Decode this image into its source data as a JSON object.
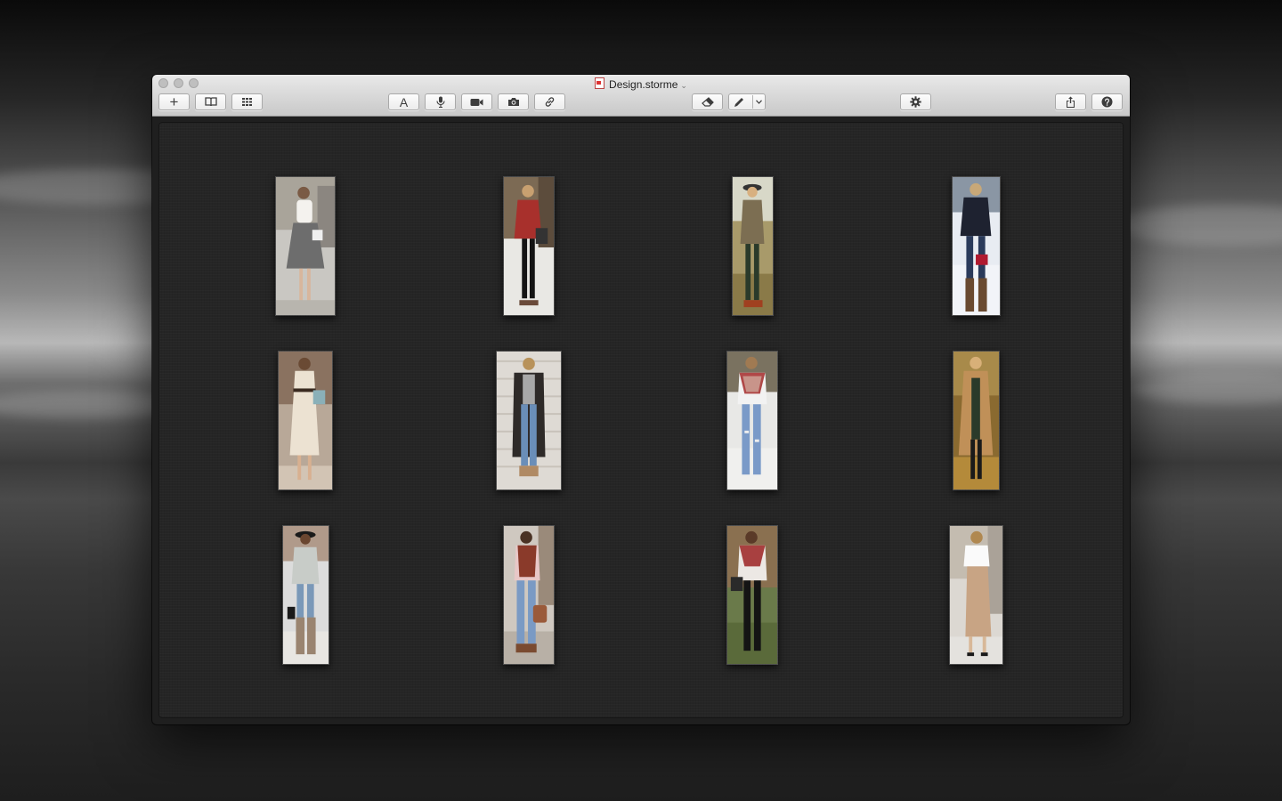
{
  "window": {
    "title": "Design.storme",
    "title_chevron": "⌄"
  },
  "toolbar": {
    "new_item": "+",
    "text_tool": "A"
  },
  "icons": {
    "add": "plus-icon",
    "library": "book-icon",
    "grid": "grid-icon",
    "text": "text-icon",
    "audio": "microphone-icon",
    "video": "video-camera-icon",
    "photo": "camera-icon",
    "link": "link-icon",
    "erase": "eraser-icon",
    "pen": "pen-icon",
    "pen_menu": "chevron-down-icon",
    "settings": "gear-icon",
    "share": "share-icon",
    "help": "help-icon"
  },
  "colors": {
    "canvas_bg": "#252525",
    "toolbar_bg": "#d7d7d7"
  },
  "photos": [
    {
      "row": 1,
      "col": 1,
      "subject": "white blouse and grey skirt"
    },
    {
      "row": 1,
      "col": 2,
      "subject": "red cardigan and black leggings"
    },
    {
      "row": 1,
      "col": 3,
      "subject": "hat and olive top"
    },
    {
      "row": 1,
      "col": 4,
      "subject": "navy sweater and jeans with boots"
    },
    {
      "row": 2,
      "col": 1,
      "subject": "cream dress with belt"
    },
    {
      "row": 2,
      "col": 2,
      "subject": "long cardigan and jeans"
    },
    {
      "row": 2,
      "col": 3,
      "subject": "plaid scarf and ripped jeans"
    },
    {
      "row": 2,
      "col": 4,
      "subject": "camel coat"
    },
    {
      "row": 3,
      "col": 1,
      "subject": "hat, grey sweater and boots"
    },
    {
      "row": 3,
      "col": 2,
      "subject": "vest and jeans with bag"
    },
    {
      "row": 3,
      "col": 3,
      "subject": "plaid scarf and black jeans"
    },
    {
      "row": 3,
      "col": 4,
      "subject": "white top and beige skirt"
    }
  ]
}
